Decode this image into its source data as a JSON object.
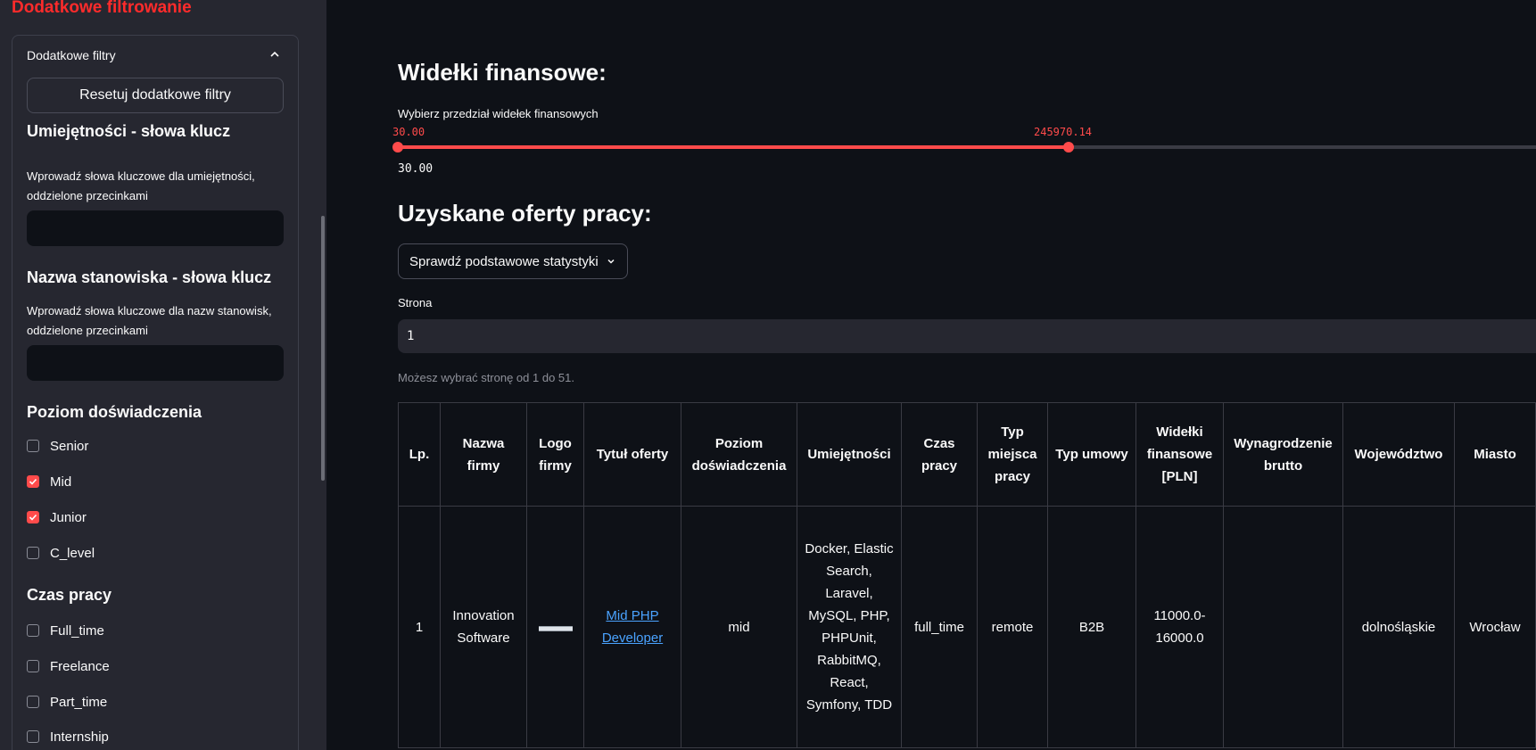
{
  "sidebar": {
    "title": "Dodatkowe filtrowanie",
    "expander_label": "Dodatkowe filtry",
    "reset_label": "Resetuj dodatkowe filtry",
    "skills": {
      "heading": "Umiejętności - słowa klucz",
      "label": "Wprowadź słowa kluczowe dla umiejętności, oddzielone przecinkami",
      "value": ""
    },
    "position": {
      "heading": "Nazwa stanowiska - słowa klucz",
      "label": "Wprowadź słowa kluczowe dla nazw stanowisk, oddzielone przecinkami",
      "value": ""
    },
    "experience": {
      "heading": "Poziom doświadczenia",
      "options": [
        {
          "label": "Senior",
          "checked": false
        },
        {
          "label": "Mid",
          "checked": true
        },
        {
          "label": "Junior",
          "checked": true
        },
        {
          "label": "C_level",
          "checked": false
        }
      ]
    },
    "worktime": {
      "heading": "Czas pracy",
      "options": [
        {
          "label": "Full_time",
          "checked": false
        },
        {
          "label": "Freelance",
          "checked": false
        },
        {
          "label": "Part_time",
          "checked": false
        },
        {
          "label": "Internship",
          "checked": false
        }
      ]
    }
  },
  "main": {
    "salary_heading": "Widełki finansowe:",
    "slider": {
      "label": "Wybierz przedział widełek finansowych",
      "low": "30.00",
      "high": "245970.14",
      "min_label": "30.00",
      "fill_fraction": 0.535
    },
    "offers_heading": "Uzyskane oferty pracy:",
    "stats_select": "Sprawdź podstawowe statystyki",
    "page_label": "Strona",
    "page_value": "1",
    "page_hint": "Możesz wybrać stronę od 1 do 51.",
    "table": {
      "headers": [
        "Lp.",
        "Nazwa firmy",
        "Logo firmy",
        "Tytuł oferty",
        "Poziom doświadczenia",
        "Umiejętności",
        "Czas pracy",
        "Typ miejsca pracy",
        "Typ umowy",
        "Widełki finansowe [PLN]",
        "Wynagrodzenie brutto",
        "Województwo",
        "Miasto"
      ],
      "rows": [
        {
          "lp": "1",
          "company": "Innovation Software",
          "title": "Mid PHP Developer",
          "level": "mid",
          "skills": "Docker, Elastic Search, Laravel, MySQL, PHP, PHPUnit, RabbitMQ, React, Symfony, TDD",
          "worktime": "full_time",
          "workplace": "remote",
          "contract": "B2B",
          "salary": "11000.0-16000.0",
          "gross": "",
          "province": "dolnośląskie",
          "city": "Wrocław"
        }
      ]
    }
  },
  "colors": {
    "accent": "#ff4b4b",
    "sidebar_bg": "#262730",
    "main_bg": "#0e1117",
    "link": "#4aa3ff"
  }
}
